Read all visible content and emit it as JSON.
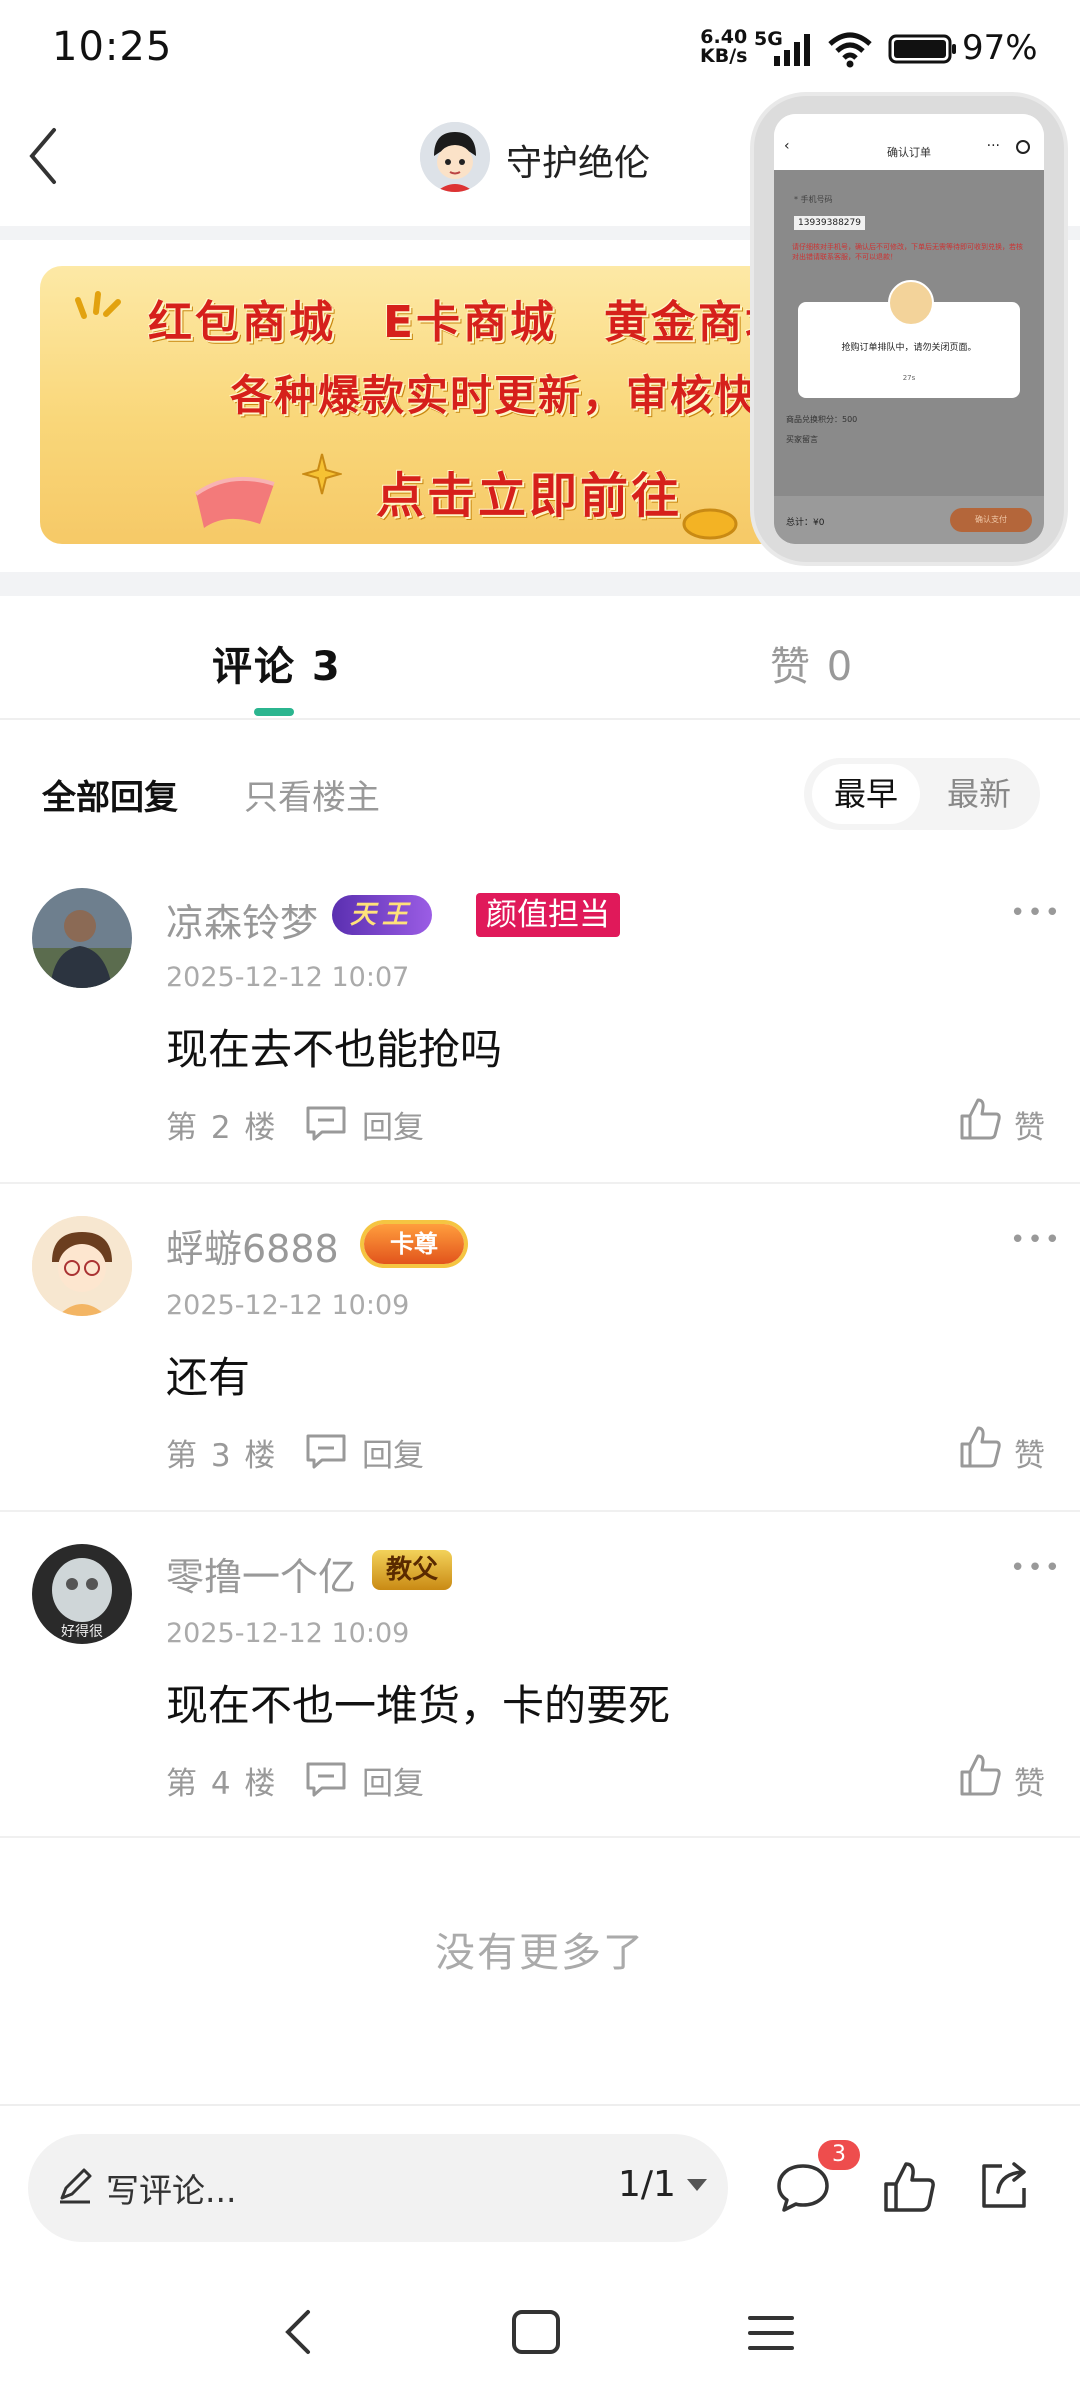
{
  "status_bar": {
    "time": "10:25",
    "net_speed_value": "6.40",
    "net_speed_unit": "KB/s",
    "network": "5G",
    "battery": "97%",
    "icons": [
      "signal-icon",
      "wifi-icon",
      "battery-icon"
    ]
  },
  "header": {
    "title": "守护绝伦",
    "back_icon": "chevron-left-icon"
  },
  "banner": {
    "line1": "红包商城　E卡商城　黄金商城",
    "line2": "各种爆款实时更新，审核快",
    "line3": "点击立即前往"
  },
  "floating_window": {
    "title": "确认订单",
    "phone_label": "* 手机号码",
    "phone": "13939388279",
    "warning": "请仔细核对手机号，确认后不可修改，下单后无需等待即可收到兑换，若核对出错请联系客服，不可以退款！",
    "dialog_text": "抢购订单排队中，请勿关闭页面。",
    "dialog_sub": "27s",
    "row1": "商品兑换积分：500",
    "row2": "买家留言",
    "total": "总计：¥0",
    "pay_button": "确认支付"
  },
  "tabs": [
    {
      "label": "评论 3",
      "active": true
    },
    {
      "label": "赞 0",
      "active": false
    }
  ],
  "filters": {
    "all": "全部回复",
    "host_only": "只看楼主",
    "sort_earliest": "最早",
    "sort_newest": "最新"
  },
  "comments": [
    {
      "name": "凉森铃梦",
      "badges": [
        "天王",
        "颜值担当"
      ],
      "time": "2025-12-12 10:07",
      "text": "现在去不也能抢吗",
      "floor": "第 2 楼",
      "reply": "回复",
      "like": "赞"
    },
    {
      "name": "蜉蝣6888",
      "badges": [
        "卡尊"
      ],
      "time": "2025-12-12 10:09",
      "text": "还有",
      "floor": "第 3 楼",
      "reply": "回复",
      "like": "赞"
    },
    {
      "name": "零撸一个亿",
      "badges": [
        "教父"
      ],
      "time": "2025-12-12 10:09",
      "text": "现在不也一堆货，卡的要死",
      "floor": "第 4 楼",
      "reply": "回复",
      "like": "赞"
    }
  ],
  "no_more": "没有更多了",
  "bottom_bar": {
    "comment_placeholder": "写评论...",
    "page_indicator": "1/1",
    "comment_badge": "3",
    "icons": [
      "pen-icon",
      "caret-down-icon",
      "comment-icon",
      "thumbs-up-icon",
      "share-icon"
    ]
  },
  "colors": {
    "accent": "#2bb58f",
    "badge_red": "#ee4d4d",
    "banner_text": "#d6201b"
  }
}
